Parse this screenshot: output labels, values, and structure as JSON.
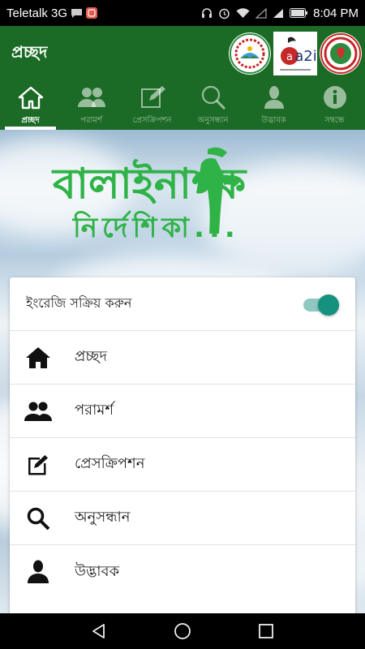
{
  "status_bar": {
    "carrier": "Teletalk 3G",
    "time": "8:04 PM"
  },
  "app_bar": {
    "title": "প্রচ্ছদ",
    "logo_a2i_text": "a2i"
  },
  "tabs": [
    {
      "label": "প্রচ্ছদ",
      "icon": "home-icon",
      "active": true
    },
    {
      "label": "পরামর্শ",
      "icon": "people-icon",
      "active": false
    },
    {
      "label": "প্রেসক্রিপশন",
      "icon": "edit-icon",
      "active": false
    },
    {
      "label": "অনুসন্ধান",
      "icon": "search-icon",
      "active": false
    },
    {
      "label": "উদ্ভাবক",
      "icon": "person-icon",
      "active": false
    },
    {
      "label": "সম্বন্ধে",
      "icon": "info-icon",
      "active": false
    }
  ],
  "banner": {
    "line1": "বালাইনাশক",
    "line2": "নির্দেশিকা..."
  },
  "card": {
    "toggle_label": "ইংরেজি সক্রিয় করুন",
    "toggle_on": true,
    "menu": [
      {
        "label": "প্রচ্ছদ",
        "icon": "home-icon"
      },
      {
        "label": "পরামর্শ",
        "icon": "people-icon"
      },
      {
        "label": "প্রেসক্রিপশন",
        "icon": "edit-icon"
      },
      {
        "label": "অনুসন্ধান",
        "icon": "search-icon"
      },
      {
        "label": "উদ্ভাবক",
        "icon": "person-icon"
      }
    ]
  },
  "colors": {
    "primary": "#1b6a25",
    "banner_green": "#2fb347",
    "toggle_accent": "#14917f"
  }
}
